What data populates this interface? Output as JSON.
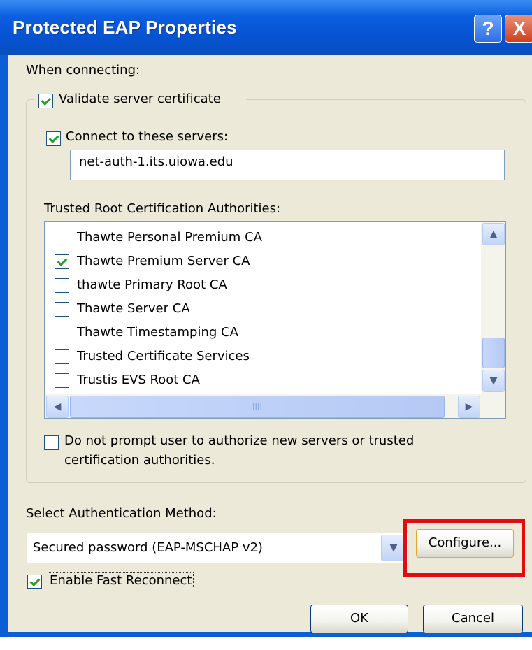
{
  "window": {
    "title": "Protected EAP Properties",
    "help_label": "?",
    "close_label": "X"
  },
  "when_connecting_label": "When connecting:",
  "validate": {
    "label": "Validate server certificate",
    "checked": true
  },
  "connect_servers": {
    "label": "Connect to these servers:",
    "checked": true,
    "value": "net-auth-1.its.uiowa.edu"
  },
  "trusted_root": {
    "label": "Trusted Root Certification Authorities:",
    "items": [
      {
        "label": "Thawte Personal Premium CA",
        "checked": false
      },
      {
        "label": "Thawte Premium Server CA",
        "checked": true
      },
      {
        "label": "thawte Primary Root CA",
        "checked": false
      },
      {
        "label": "Thawte Server CA",
        "checked": false
      },
      {
        "label": "Thawte Timestamping CA",
        "checked": false
      },
      {
        "label": "Trusted Certificate Services",
        "checked": false
      },
      {
        "label": "Trustis EVS Root CA",
        "checked": false
      }
    ]
  },
  "do_not_prompt": {
    "label_line1": "Do not prompt user to authorize new servers or trusted",
    "label_line2": "certification authorities.",
    "checked": false
  },
  "auth_method": {
    "label": "Select Authentication Method:",
    "selected": "Secured password (EAP-MSCHAP v2)",
    "configure_label": "Configure..."
  },
  "fast_reconnect": {
    "label": "Enable Fast Reconnect",
    "checked": true
  },
  "buttons": {
    "ok": "OK",
    "cancel": "Cancel"
  },
  "scrollbar": {
    "grip": "IIII",
    "up": "▲",
    "down": "▼",
    "left": "◀",
    "right": "▶"
  },
  "highlight_color": "#e10b10"
}
